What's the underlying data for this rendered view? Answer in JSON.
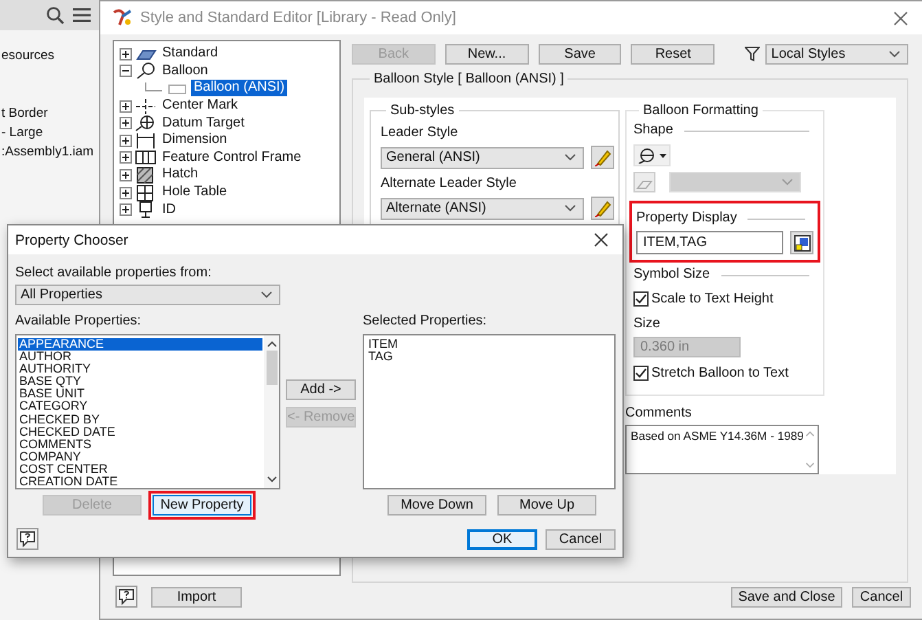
{
  "background_panel": {
    "items": [
      "esources",
      "t Border",
      "- Large",
      ":Assembly1.iam"
    ]
  },
  "editor": {
    "title": "Style and Standard Editor [Library - Read Only]",
    "tree": [
      {
        "label": "Standard",
        "expanded": false,
        "selected": false
      },
      {
        "label": "Balloon",
        "expanded": true,
        "selected": false,
        "children": [
          {
            "label": "Balloon (ANSI)",
            "selected": true
          }
        ]
      },
      {
        "label": "Center Mark",
        "expanded": false,
        "selected": false
      },
      {
        "label": "Datum Target",
        "expanded": false,
        "selected": false
      },
      {
        "label": "Dimension",
        "expanded": false,
        "selected": false
      },
      {
        "label": "Feature Control Frame",
        "expanded": false,
        "selected": false
      },
      {
        "label": "Hatch",
        "expanded": false,
        "selected": false
      },
      {
        "label": "Hole Table",
        "expanded": false,
        "selected": false
      },
      {
        "label": "ID",
        "expanded": false,
        "selected": false
      }
    ],
    "toolbar": [
      {
        "label": "Back",
        "disabled": true
      },
      {
        "label": "New...",
        "disabled": false
      },
      {
        "label": "Save",
        "disabled": false
      },
      {
        "label": "Reset",
        "disabled": false
      }
    ],
    "filter": "Local Styles",
    "group_title": "Balloon Style [ Balloon (ANSI) ]",
    "substyles": {
      "title": "Sub-styles",
      "fields": [
        {
          "label": "Leader Style",
          "value": "General (ANSI)"
        },
        {
          "label": "Alternate Leader Style",
          "value": "Alternate (ANSI)"
        }
      ]
    },
    "formatting": {
      "title": "Balloon Formatting",
      "shape_label": "Shape",
      "property_display": {
        "label": "Property Display",
        "value": "ITEM,TAG",
        "highlighted": true
      },
      "symbol_size": "Symbol Size",
      "scale": {
        "label": "Scale to Text Height",
        "checked": true
      },
      "size": {
        "label": "Size",
        "value": "0.360 in",
        "disabled": true
      },
      "stretch": {
        "label": "Stretch Balloon to Text",
        "checked": true
      }
    },
    "comments": {
      "label": "Comments",
      "value": "Based on ASME Y14.36M - 1989"
    },
    "footer": {
      "import": "Import",
      "save_close": "Save and Close",
      "cancel": "Cancel"
    }
  },
  "dialog": {
    "title": "Property Chooser",
    "source_label": "Select available properties from:",
    "source_value": "All Properties",
    "available_label": "Available Properties:",
    "available": [
      {
        "label": "APPEARANCE",
        "selected": true
      },
      {
        "label": "AUTHOR",
        "selected": false
      },
      {
        "label": "AUTHORITY",
        "selected": false
      },
      {
        "label": "BASE QTY",
        "selected": false
      },
      {
        "label": "BASE UNIT",
        "selected": false
      },
      {
        "label": "CATEGORY",
        "selected": false
      },
      {
        "label": "CHECKED BY",
        "selected": false
      },
      {
        "label": "CHECKED DATE",
        "selected": false
      },
      {
        "label": "COMMENTS",
        "selected": false
      },
      {
        "label": "COMPANY",
        "selected": false
      },
      {
        "label": "COST CENTER",
        "selected": false
      },
      {
        "label": "CREATION DATE",
        "selected": false
      }
    ],
    "add": {
      "label": "Add ->",
      "disabled": false
    },
    "remove": {
      "label": "<- Remove",
      "disabled": true
    },
    "selected_label": "Selected Properties:",
    "selected_items": [
      "ITEM",
      "TAG"
    ],
    "delete": {
      "label": "Delete",
      "disabled": true
    },
    "new_property": {
      "label": "New Property",
      "highlighted": true
    },
    "move_down": "Move Down",
    "move_up": "Move Up",
    "ok": "OK",
    "cancel": "Cancel"
  }
}
